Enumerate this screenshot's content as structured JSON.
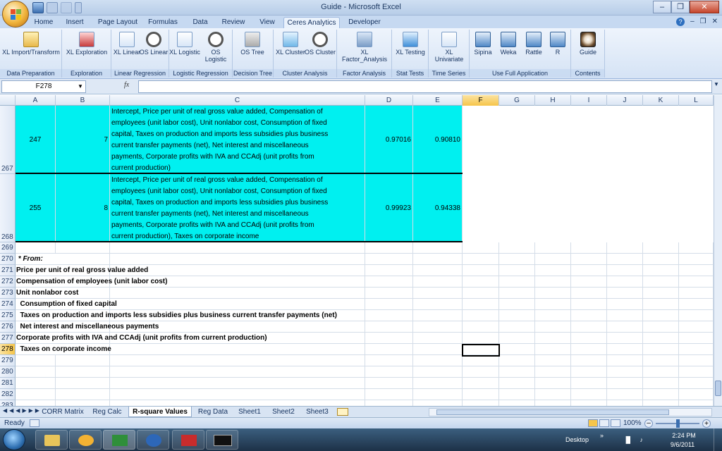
{
  "window": {
    "title": "Guide - Microsoft Excel"
  },
  "ribbon_tabs": [
    "Home",
    "Insert",
    "Page Layout",
    "Formulas",
    "Data",
    "Review",
    "View",
    "Ceres Analytics",
    "Developer"
  ],
  "active_tab": "Ceres Analytics",
  "ribbon_groups": [
    {
      "label": "Data Preparation",
      "buttons": [
        {
          "label": "XL Import/Transform",
          "icon": "import-transform-icon"
        }
      ]
    },
    {
      "label": "Exploration",
      "buttons": [
        {
          "label": "XL Exploration",
          "icon": "exploration-icon"
        }
      ]
    },
    {
      "label": "Linear Regression",
      "buttons": [
        {
          "label": "XL Linear",
          "icon": "xl-linear-icon"
        },
        {
          "label": "OS Linear",
          "icon": "os-linear-icon"
        }
      ]
    },
    {
      "label": "Logistic Regression",
      "buttons": [
        {
          "label": "XL Logistic",
          "icon": "xl-logistic-icon"
        },
        {
          "label": "OS Logistic",
          "icon": "os-logistic-icon"
        }
      ]
    },
    {
      "label": "Decision Tree",
      "buttons": [
        {
          "label": "OS Tree",
          "icon": "tree-icon"
        }
      ]
    },
    {
      "label": "Cluster Analysis",
      "buttons": [
        {
          "label": "XL Cluster",
          "icon": "xl-cluster-icon"
        },
        {
          "label": "OS Cluster",
          "icon": "os-cluster-icon"
        }
      ]
    },
    {
      "label": "Factor Analysis",
      "buttons": [
        {
          "label": "XL Factor_Analysis",
          "icon": "factor-analysis-icon"
        }
      ]
    },
    {
      "label": "Stat Tests",
      "buttons": [
        {
          "label": "XL Testing",
          "icon": "testing-icon"
        }
      ]
    },
    {
      "label": "Time Series",
      "buttons": [
        {
          "label": "XL Univariate",
          "icon": "univariate-icon"
        }
      ]
    },
    {
      "label": "Use Full Application",
      "buttons": [
        {
          "label": "Sipina",
          "icon": "sipina-icon"
        },
        {
          "label": "Weka",
          "icon": "weka-icon"
        },
        {
          "label": "Rattle",
          "icon": "rattle-icon"
        },
        {
          "label": "R",
          "icon": "r-icon"
        }
      ]
    },
    {
      "label": "Contents",
      "buttons": [
        {
          "label": "Guide",
          "icon": "guide-icon"
        }
      ]
    }
  ],
  "namebox": "F278",
  "formula": "",
  "columns": [
    "A",
    "B",
    "C",
    "D",
    "E",
    "F",
    "G",
    "H",
    "I",
    "J",
    "K",
    "L"
  ],
  "selected_column": "F",
  "rows": {
    "r267": {
      "num": "267",
      "a": "247",
      "b": "7",
      "c": [
        "Intercept, Price per unit of real gross value added, Compensation of",
        "employees (unit labor cost), Unit nonlabor cost,   Consumption of fixed",
        "capital,   Taxes on production and imports less subsidies plus business",
        "current transfer payments (net),   Net interest and miscellaneous",
        "payments, Corporate profits with IVA and CCAdj (unit profits from",
        "current production)"
      ],
      "d": "0.97016",
      "e": "0.90810"
    },
    "r268": {
      "num": "268",
      "a": "255",
      "b": "8",
      "c": [
        "Intercept, Price per unit of real gross value added, Compensation of",
        "employees (unit labor cost), Unit nonlabor cost,   Consumption of fixed",
        "capital,   Taxes on production and imports less subsidies plus business",
        "current transfer payments (net),   Net interest and miscellaneous",
        "payments, Corporate profits with IVA and CCAdj (unit profits from",
        "current production),   Taxes on corporate income"
      ],
      "d": "0.99923",
      "e": "0.94338"
    },
    "simple": [
      {
        "num": "269",
        "text": ""
      },
      {
        "num": "270",
        "text": " * From:"
      },
      {
        "num": "271",
        "text": "Price per unit of real gross value added"
      },
      {
        "num": "272",
        "text": "Compensation of employees (unit labor cost)"
      },
      {
        "num": "273",
        "text": "Unit nonlabor cost"
      },
      {
        "num": "274",
        "text": "  Consumption of fixed capital"
      },
      {
        "num": "275",
        "text": "  Taxes on production and imports less subsidies plus business current transfer payments (net)"
      },
      {
        "num": "276",
        "text": "  Net interest and miscellaneous payments"
      },
      {
        "num": "277",
        "text": "Corporate profits with IVA and CCAdj (unit profits from current production)"
      },
      {
        "num": "278",
        "text": "  Taxes on corporate income"
      },
      {
        "num": "279",
        "text": ""
      },
      {
        "num": "280",
        "text": ""
      },
      {
        "num": "281",
        "text": ""
      },
      {
        "num": "282",
        "text": ""
      },
      {
        "num": "283",
        "text": ""
      }
    ]
  },
  "selected_row": "278",
  "sheet_tabs": [
    "CORR Matrix",
    "Reg Calc",
    "R-square Values",
    "Reg Data",
    "Sheet1",
    "Sheet2",
    "Sheet3"
  ],
  "active_sheet": "R-square Values",
  "status": {
    "ready": "Ready",
    "zoom": "100%"
  },
  "taskbar": {
    "desktop": "Desktop",
    "time": "2:24 PM",
    "date": "9/6/2011"
  },
  "colors": {
    "cyan_fill": "#00f0f0",
    "ribbon": "#d5e3f5",
    "selection": "#f6c54a"
  }
}
